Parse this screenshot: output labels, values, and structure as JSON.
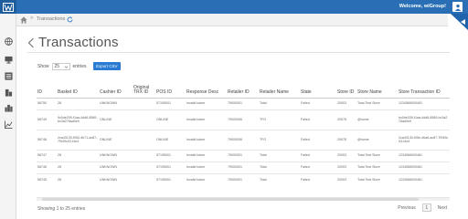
{
  "header": {
    "welcome": "Welcome, wiGroup!",
    "brand_color": "#2a6fb5"
  },
  "sidebar": {
    "items": [
      {
        "icon": "globe-icon"
      },
      {
        "icon": "monitor-icon"
      },
      {
        "icon": "list-icon"
      },
      {
        "icon": "building-icon"
      },
      {
        "icon": "city-icon"
      },
      {
        "icon": "chart-line-icon"
      }
    ]
  },
  "breadcrumb": {
    "separator": "»",
    "current": "Transactions"
  },
  "page": {
    "title": "Transactions",
    "show_label": "Show",
    "page_size": "25",
    "entries_label": "entries",
    "export_label": "Export CSV"
  },
  "table": {
    "columns": [
      "ID",
      "Basket ID",
      "Cashier ID",
      "Original TRX ID",
      "POS ID",
      "Response Desc",
      "Retailer ID",
      "Retailer Name",
      "State",
      "Store ID",
      "Store Name",
      "Store Transaction ID"
    ],
    "rows": [
      [
        "58750",
        "28",
        "UNKNOWN",
        "",
        "57195001",
        "Invalid token",
        "79000001",
        "Total",
        "Failed",
        "20003",
        "Total Test Store",
        "1234566000461"
      ],
      [
        "58749",
        "9c0de209-f1aa-4dd6-8589-bc3a276ad0e9",
        "ONLINE",
        "",
        "ONLINE",
        "Invalid token",
        "79000006",
        "TFG",
        "Failed",
        "20078",
        "@home",
        "bc0de209-f1aa-4dd6-8589-bc3a276ad0e9"
      ],
      [
        "58748",
        "2ca43130-f050-4b71-ac87-7f949c03-f4e4",
        "ONLINE",
        "",
        "ONLINE",
        "Invalid token",
        "79000006",
        "TFG",
        "Failed",
        "20078",
        "@home",
        "2ca43130-f05e-4ba6-ac87-7f949c03-f4e4"
      ],
      [
        "58747",
        "28",
        "UNKNOWN",
        "",
        "57195001",
        "Invalid token",
        "79000001",
        "Total",
        "Failed",
        "20003",
        "Total Test Store",
        "1234566000461"
      ],
      [
        "58746",
        "28",
        "UNKNOWN",
        "",
        "57195001",
        "Invalid token",
        "79000001",
        "Total",
        "Failed",
        "20003",
        "Total Test Store",
        "1234566000461"
      ],
      [
        "58745",
        "28",
        "UNKNOWN",
        "",
        "57195001",
        "Invalid token",
        "79000001",
        "Total",
        "Failed",
        "20003",
        "Total Test Store",
        "1234566000461"
      ]
    ]
  },
  "footer": {
    "info": "Showing 1 to 25 entries",
    "previous": "Previous",
    "current_page": "1",
    "next": "Next"
  }
}
